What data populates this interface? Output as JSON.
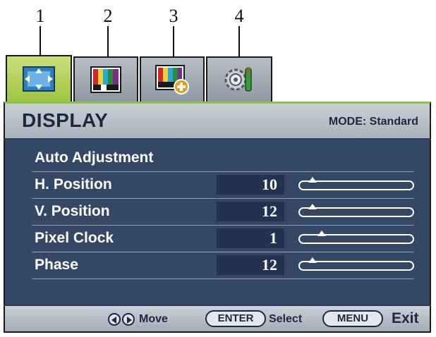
{
  "callouts": [
    "1",
    "2",
    "3",
    "4"
  ],
  "tabs": [
    {
      "name": "display-tab",
      "icon": "display-arrows-icon",
      "active": true
    },
    {
      "name": "picture-tab",
      "icon": "color-bars-icon",
      "active": false
    },
    {
      "name": "picture-advanced-tab",
      "icon": "color-bars-plus-icon",
      "active": false
    },
    {
      "name": "system-tab",
      "icon": "gear-wrench-icon",
      "active": false
    }
  ],
  "header": {
    "title": "DISPLAY",
    "mode": "MODE: Standard"
  },
  "menu": {
    "auto_adjustment": "Auto Adjustment",
    "items": [
      {
        "label": "H. Position",
        "value": "10",
        "level": 0.12
      },
      {
        "label": "V. Position",
        "value": "12",
        "level": 0.12
      },
      {
        "label": "Pixel Clock",
        "value": "1",
        "level": 0.2
      },
      {
        "label": "Phase",
        "value": "12",
        "level": 0.12
      }
    ]
  },
  "footer": {
    "move": "Move",
    "enter": "ENTER",
    "select": "Select",
    "menu": "MENU",
    "exit": "Exit"
  },
  "colors": {
    "panel": "#344765",
    "active_tab": "#9fc444",
    "accent_line": "#8ec43c",
    "header": "#b8c1c9"
  }
}
